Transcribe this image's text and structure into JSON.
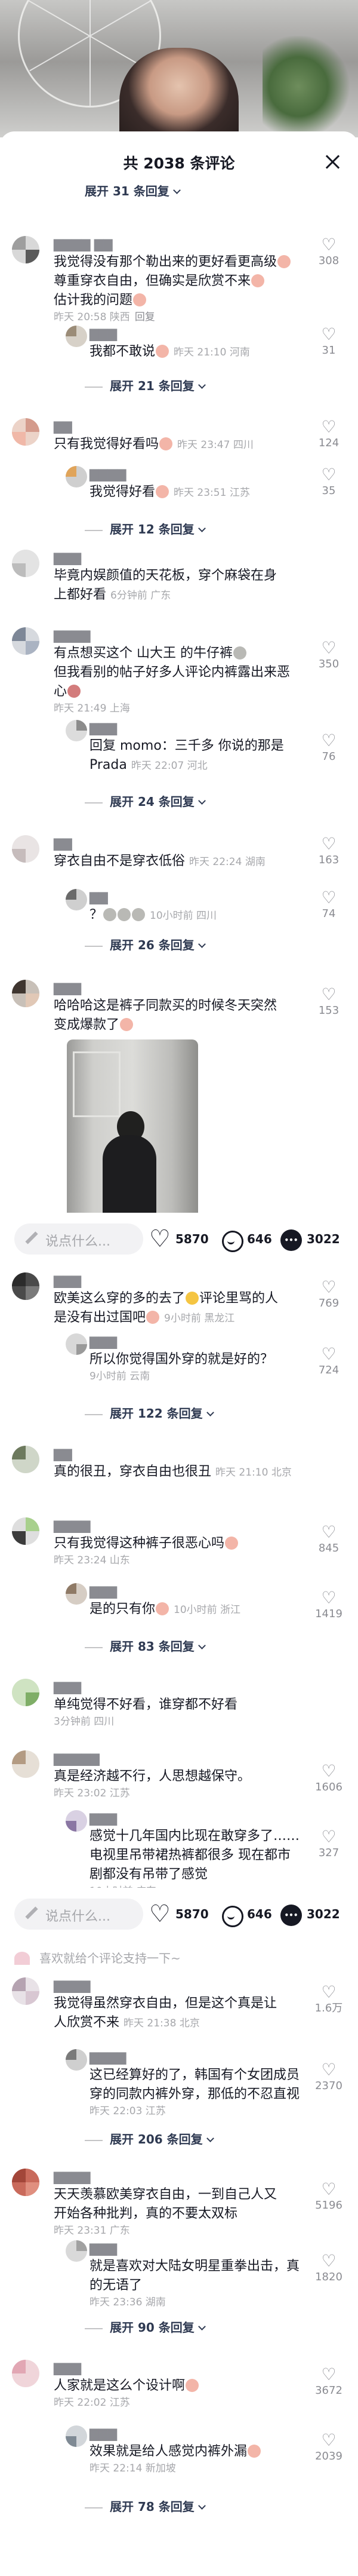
{
  "header": {
    "title": "共 2038 条评论"
  },
  "input_bar": {
    "placeholder": "说点什么...",
    "likes": "5870",
    "collects": "646",
    "comments": "3022"
  },
  "emoji_tip": "喜欢就给个评论支持一下~",
  "expand_top": "展开 31 条回复",
  "comments": [
    {
      "text_a": "我觉得没有那个勒出来的更好看更高级",
      "text_b": "尊重穿衣自由，但确实是欣赏不来",
      "text_c": "估计我的问题",
      "meta": "昨天 20:58 陕西",
      "reply": "回复",
      "likes": "308",
      "subs": [
        {
          "text": "我都不敢说",
          "meta": "昨天 21:10 河南",
          "likes": "31"
        }
      ],
      "expand": "展开 21 条回复"
    },
    {
      "text": "只有我觉得好看吗",
      "meta": "昨天 23:47 四川",
      "likes": "124",
      "subs": [
        {
          "text": "我觉得好看",
          "meta": "昨天 23:51 江苏",
          "likes": "35"
        }
      ],
      "expand": "展开 12 条回复"
    },
    {
      "text_a": "毕竟内娱颜值的天花板，穿个麻袋在身",
      "text_b": "上都好看",
      "meta": "6分钟前 广东",
      "likes": ""
    },
    {
      "text_a": "有点想买这个 山大王 的牛仔裤",
      "text_b": "但我看别的帖子好多人评论内裤露出来恶",
      "text_c": "心",
      "meta": "昨天 21:49 上海",
      "likes": "350",
      "subs": [
        {
          "text_a": "回复 momo：三千多 你说的那是",
          "text_b": "Prada",
          "meta": "昨天 22:07 河北",
          "likes": "76"
        }
      ],
      "expand": "展开 24 条回复"
    },
    {
      "text": "穿衣自由不是穿衣低俗",
      "meta": "昨天 22:24 湖南",
      "likes": "163",
      "subs": [
        {
          "text": "？",
          "meta": "10小时前 四川",
          "likes": "74"
        }
      ],
      "expand": "展开 26 条回复"
    },
    {
      "text_a": "哈哈哈这是裤子同款买的时候冬天突然",
      "text_b": "变成爆款了",
      "meta": "",
      "likes": "153"
    },
    {
      "text_a": "欧美这么穿的多的去了",
      "text_b": "评论里骂的人",
      "text_c": "是没有出过国吧",
      "meta": "9小时前 黑龙江",
      "likes": "769",
      "subs": [
        {
          "text": "所以你觉得国外穿的就是好的？",
          "meta": "9小时前 云南",
          "likes": "724"
        }
      ],
      "expand": "展开 122 条回复"
    },
    {
      "text": "真的很丑，穿衣自由也很丑",
      "meta": "昨天 21:10 北京",
      "likes": ""
    },
    {
      "text": "只有我觉得这种裤子很恶心吗",
      "meta": "昨天 23:24 山东",
      "likes": "845",
      "subs": [
        {
          "text": "是的只有你",
          "meta": "10小时前 浙江",
          "likes": "1419"
        }
      ],
      "expand": "展开 83 条回复"
    },
    {
      "text": "单纯觉得不好看，谁穿都不好看",
      "meta": "3分钟前 四川",
      "likes": ""
    },
    {
      "text": "真是经济越不行，人思想越保守。",
      "meta": "昨天 23:02 江苏",
      "likes": "1606",
      "subs": [
        {
          "text_a": "感觉十几年国内比现在敢穿多了……",
          "text_b": "电视里吊带裙热裤都很多 现在都市",
          "text_c": "剧都没有吊带了感觉",
          "meta": "10小时前 广东",
          "likes": "327"
        }
      ]
    },
    {
      "text_a": "我觉得虽然穿衣自由，但是这个真是让",
      "text_b": "人欣赏不来",
      "meta": "昨天 21:38 北京",
      "likes": "1.6万",
      "subs": [
        {
          "text_a": "这已经算好的了，韩国有个女团成员",
          "text_b": "穿的同款内裤外穿，那低的不忍直视",
          "meta": "昨天 22:03 江苏",
          "likes": "2370"
        }
      ],
      "expand": "展开 206 条回复"
    },
    {
      "text_a": "天天羡慕欧美穿衣自由，一到自己人又",
      "text_b": "开始各种批判，真的不要太双标",
      "meta": "昨天 23:31 广东",
      "likes": "5196",
      "subs": [
        {
          "text_a": "就是喜欢对大陆女明星重拳出击，真",
          "text_b": "的无语了",
          "meta": "昨天 23:36 湖南",
          "likes": "1820"
        }
      ],
      "expand": "展开 90 条回复"
    },
    {
      "text": "人家就是这么个设计啊",
      "meta": "昨天 22:02 江苏",
      "likes": "3672",
      "subs": [
        {
          "text": "效果就是给人感觉内裤外漏",
          "meta": "昨天 22:14 新加坡",
          "likes": "2039"
        }
      ],
      "expand": "展开 78 条回复"
    }
  ]
}
